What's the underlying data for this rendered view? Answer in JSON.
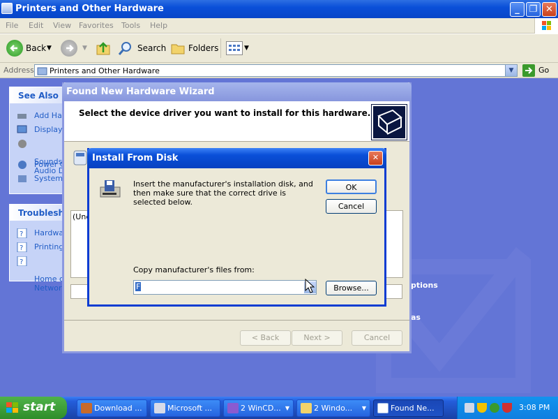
{
  "explorer": {
    "title": "Printers and Other Hardware",
    "menu": [
      "File",
      "Edit",
      "View",
      "Favorites",
      "Tools",
      "Help"
    ],
    "toolbar": {
      "back": "Back",
      "search": "Search",
      "folders": "Folders"
    },
    "address_label": "Address",
    "address_value": "Printers and Other Hardware",
    "go_label": "Go"
  },
  "see_also": {
    "title": "See Also",
    "items": [
      "Add Har",
      "Display",
      "Sounds,\nAudio De",
      "Power C",
      "System"
    ]
  },
  "troubleshoot": {
    "title": "Troublesho",
    "items": [
      "Hardwar",
      "Printing",
      "Home or\nNetwork"
    ]
  },
  "right_fragments": {
    "options": "ptions",
    "as": "as"
  },
  "wizard": {
    "title": "Found New Hardware Wizard",
    "heading": "Select the device driver you want to install for this hardware.",
    "list_fragment": "(Une",
    "buttons": {
      "back": "< Back",
      "next": "Next >",
      "cancel": "Cancel"
    }
  },
  "dialog": {
    "title": "Install From Disk",
    "message": "Insert the manufacturer's installation disk, and then make sure that the correct drive is selected below.",
    "ok": "OK",
    "cancel": "Cancel",
    "copy_label": "Copy manufacturer's files from:",
    "path_value": "F",
    "browse": "Browse..."
  },
  "taskbar": {
    "start": "start",
    "buttons": [
      "Download ...",
      "Microsoft ...",
      "2 WinCD...",
      "2 Windo...",
      "Found Ne..."
    ],
    "clock": "3:08 PM"
  },
  "colors": {
    "xp_blue": "#0a4fd8",
    "taskbar_green": "#2e8d2a",
    "panel_link": "#215dc6"
  }
}
